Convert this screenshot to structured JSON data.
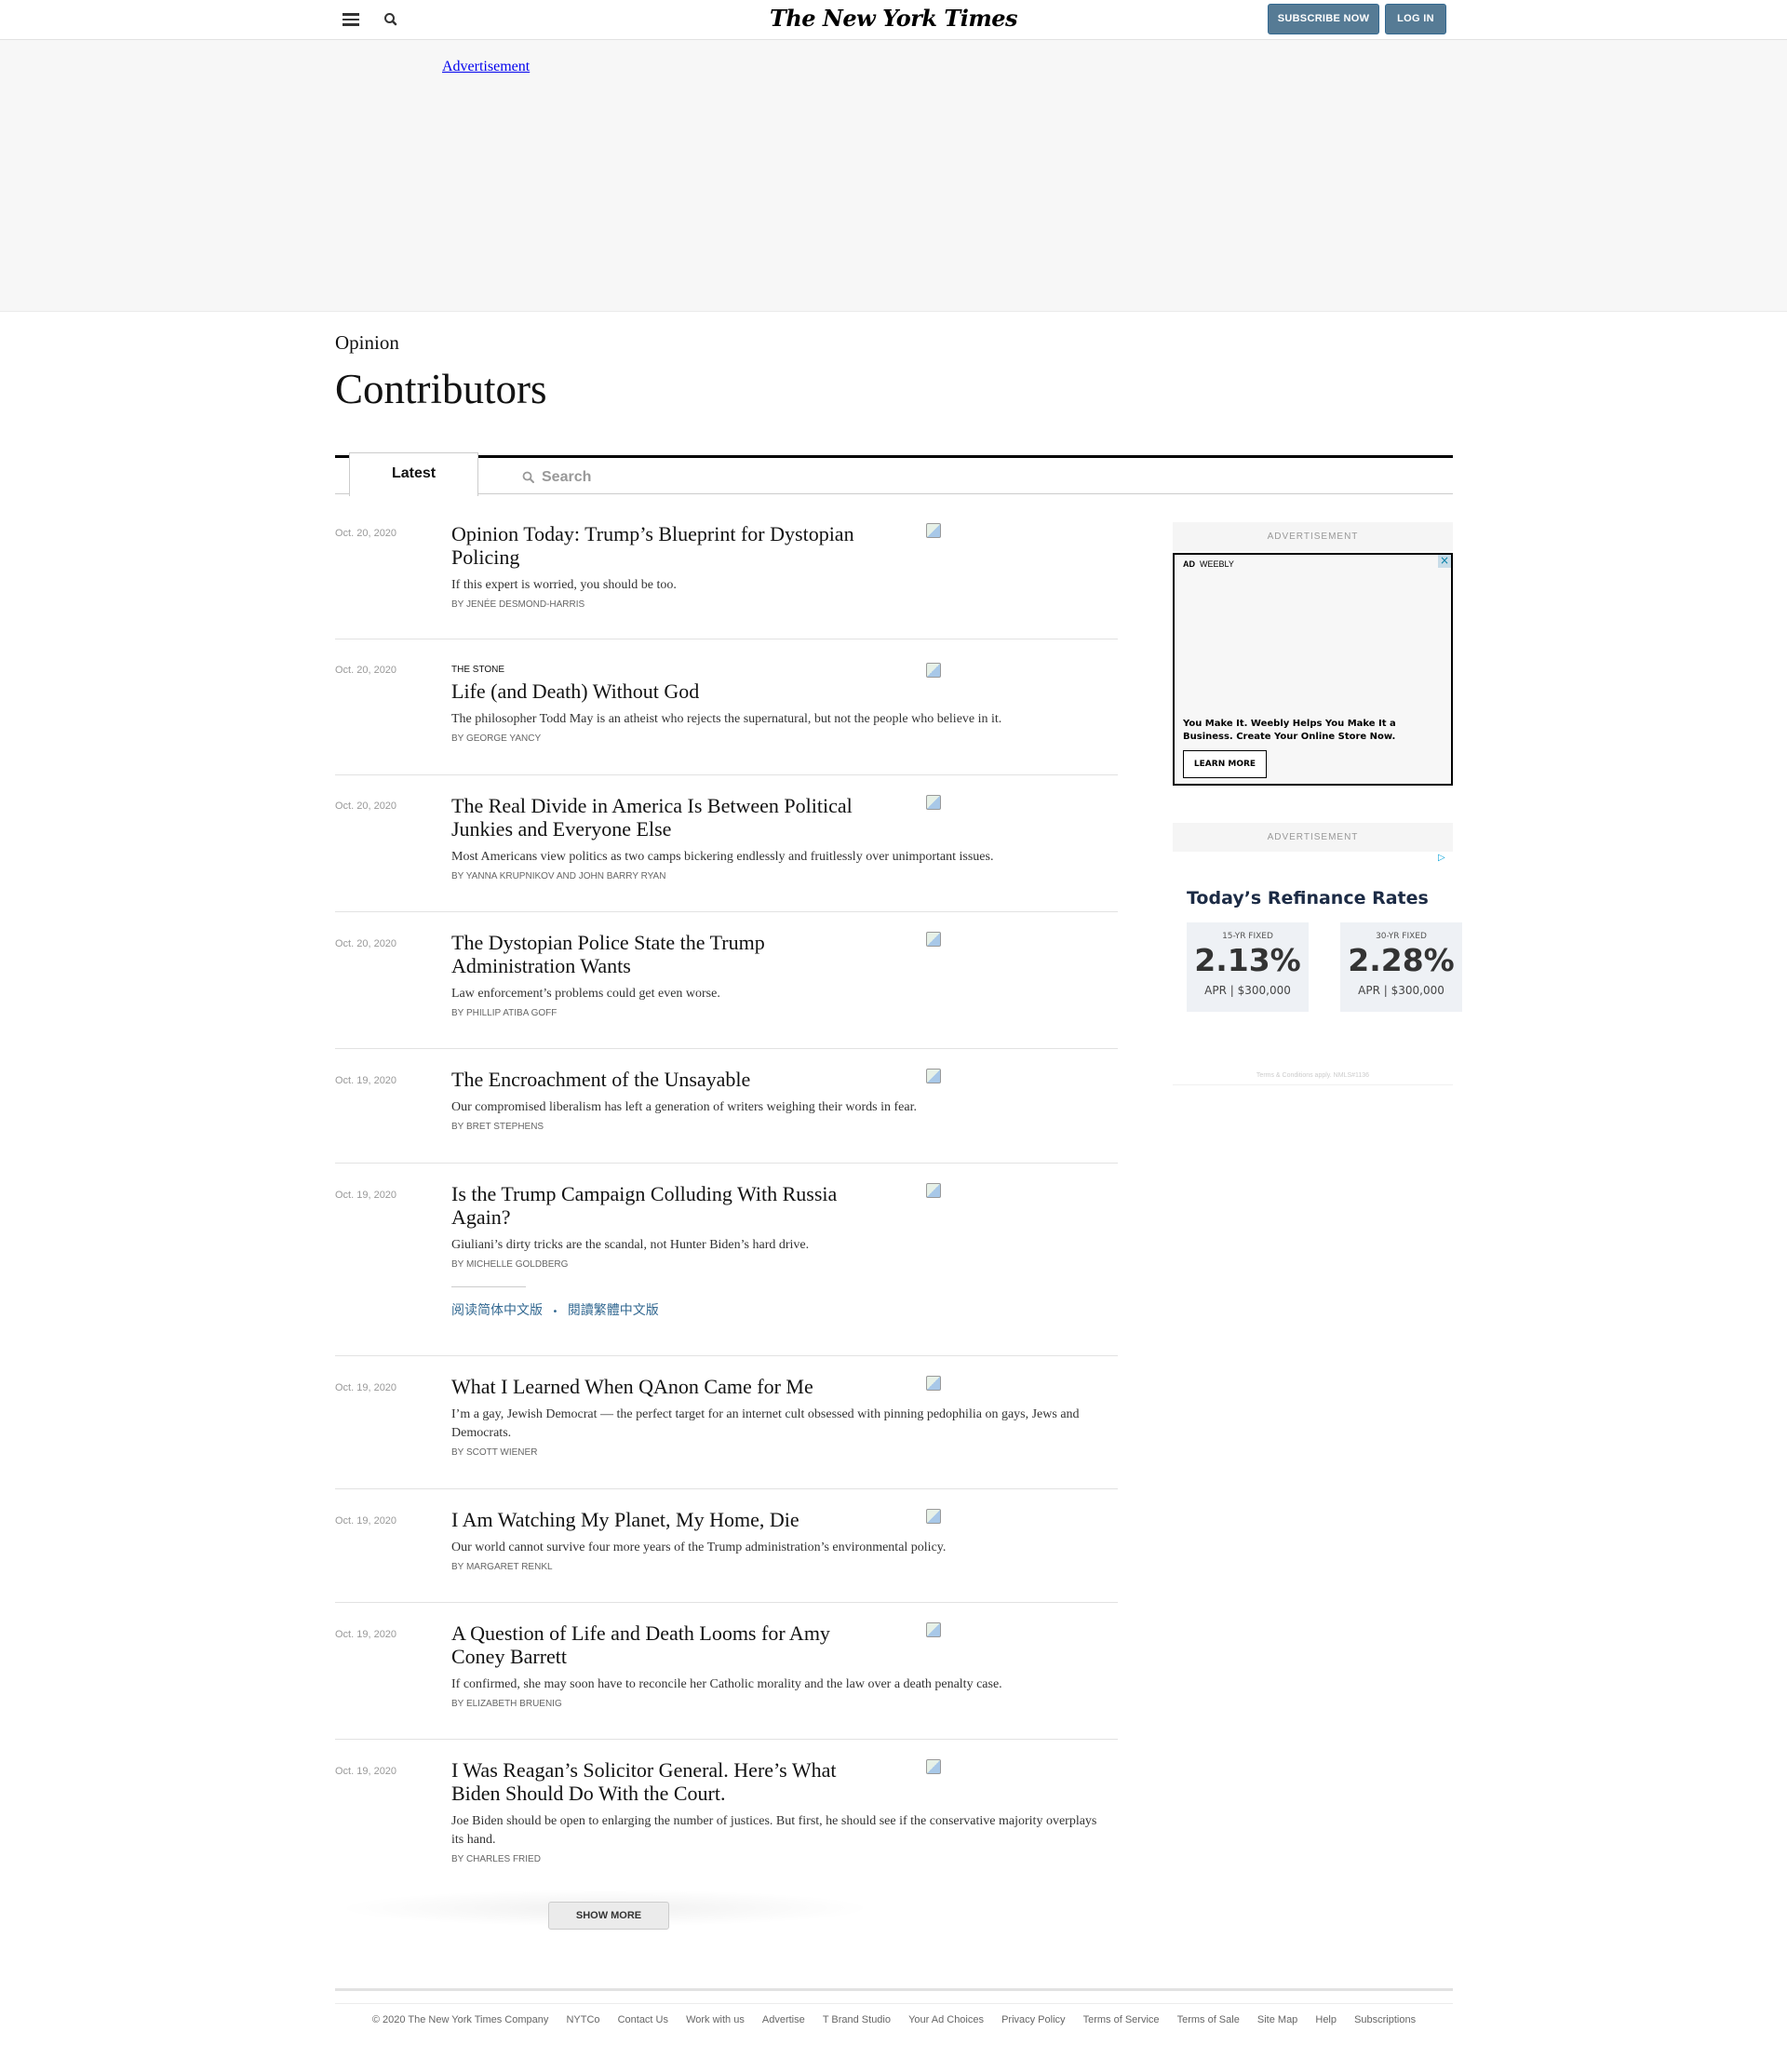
{
  "header": {
    "logo": "The New York Times",
    "menu_icon": "hamburger-icon",
    "search_icon": "search-icon",
    "subscribe_label": "SUBSCRIBE NOW",
    "login_label": "LOG IN"
  },
  "top_ad": {
    "alt_text": "Advertisement"
  },
  "page": {
    "kicker": "Opinion",
    "title": "Contributors"
  },
  "tabs": {
    "latest_label": "Latest",
    "search_placeholder": "Search"
  },
  "articles": [
    {
      "date": "Oct. 20, 2020",
      "label": "",
      "headline": "Opinion Today: Trump’s Blueprint for Dystopian Policing",
      "summary": "If this expert is worried, you should be too.",
      "byline": "By JENÉE DESMOND-HARRIS"
    },
    {
      "date": "Oct. 20, 2020",
      "label": "THE STONE",
      "headline": "Life (and Death) Without God",
      "summary": "The philosopher Todd May is an atheist who rejects the supernatural, but not the people who believe in it.",
      "byline": "By GEORGE YANCY"
    },
    {
      "date": "Oct. 20, 2020",
      "label": "",
      "headline": "The Real Divide in America Is Between Political Junkies and Everyone Else",
      "summary": "Most Americans view politics as two camps bickering endlessly and fruitlessly over unimportant issues.",
      "byline": "By YANNA KRUPNIKOV and JOHN BARRY RYAN"
    },
    {
      "date": "Oct. 20, 2020",
      "label": "",
      "headline": "The Dystopian Police State the Trump Administration Wants",
      "summary": "Law enforcement’s problems could get even worse.",
      "byline": "By PHILLIP ATIBA GOFF"
    },
    {
      "date": "Oct. 19, 2020",
      "label": "",
      "headline": "The Encroachment of the Unsayable",
      "summary": "Our compromised liberalism has left a generation of writers weighing their words in fear.",
      "byline": "By BRET STEPHENS"
    },
    {
      "date": "Oct. 19, 2020",
      "label": "",
      "headline": "Is the Trump Campaign Colluding With Russia Again?",
      "summary": "Giuliani’s dirty tricks are the scandal, not Hunter Biden’s hard drive.",
      "byline": "By MICHELLE GOLDBERG",
      "translation_simplified": "阅读简体中文版",
      "translation_sep": "•",
      "translation_traditional": "閱讀繁體中文版"
    },
    {
      "date": "Oct. 19, 2020",
      "label": "",
      "headline": "What I Learned When QAnon Came for Me",
      "summary": "I’m a gay, Jewish Democrat — the perfect target for an internet cult obsessed with pinning pedophilia on gays, Jews and Democrats.",
      "byline": "By SCOTT WIENER"
    },
    {
      "date": "Oct. 19, 2020",
      "label": "",
      "headline": "I Am Watching My Planet, My Home, Die",
      "summary": "Our world cannot survive four more years of the Trump administration’s environmental policy.",
      "byline": "By MARGARET RENKL"
    },
    {
      "date": "Oct. 19, 2020",
      "label": "",
      "headline": "A Question of Life and Death Looms for Amy Coney Barrett",
      "summary": "If confirmed, she may soon have to reconcile her Catholic morality and the law over a death penalty case.",
      "byline": "By ELIZABETH BRUENIG"
    },
    {
      "date": "Oct. 19, 2020",
      "label": "",
      "headline": "I Was Reagan’s Solicitor General. Here’s What Biden Should Do With the Court.",
      "summary": "Joe Biden should be open to enlarging the number of justices. But first, he should see if the conservative majority overplays its hand.",
      "byline": "By CHARLES FRIED"
    }
  ],
  "show_more_label": "SHOW MORE",
  "rail": {
    "ad_label": "ADVERTISEMENT",
    "weebly": {
      "tag_ad": "AD",
      "tag_brand": "WEEBLY",
      "text": "You Make It. Weebly Helps You Make It a Business. Create Your Online Store Now.",
      "button": "LEARN MORE",
      "choice_icon": "adchoices-x-icon"
    },
    "rates": {
      "title": "Today’s Refinance Rates",
      "cards": [
        {
          "kind": "15-YR FIXED",
          "value": "2.13%",
          "sub": "APR | $300,000"
        },
        {
          "kind": "30-YR FIXED",
          "value": "2.28%",
          "sub": "APR | $300,000"
        }
      ],
      "terms": "Terms & Conditions apply. NMLS#1136",
      "choice_icon": "adchoices-triangle-icon"
    }
  },
  "footer": {
    "copyright": "© 2020 The New York Times Company",
    "links": [
      "NYTCo",
      "Contact Us",
      "Work with us",
      "Advertise",
      "T Brand Studio",
      "Your Ad Choices",
      "Privacy Policy",
      "Terms of Service",
      "Terms of Sale",
      "Site Map",
      "Help",
      "Subscriptions"
    ]
  }
}
